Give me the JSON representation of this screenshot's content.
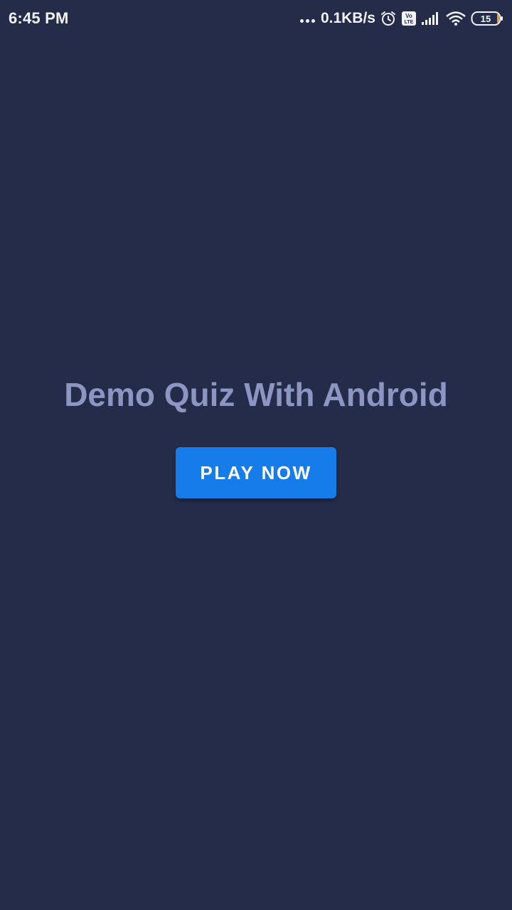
{
  "status_bar": {
    "time": "6:45 PM",
    "network_speed": "0.1KB/s",
    "battery_level": "15",
    "icons": [
      "more-dots-icon",
      "alarm-icon",
      "volte-icon",
      "signal-icon",
      "wifi-icon",
      "battery-icon"
    ]
  },
  "main": {
    "title": "Demo Quiz With Android",
    "play_button_label": "PLAY NOW"
  },
  "colors": {
    "background": "#252c49",
    "title_text": "#8d95c3",
    "button": "#157cea",
    "button_text": "#ffffff"
  }
}
